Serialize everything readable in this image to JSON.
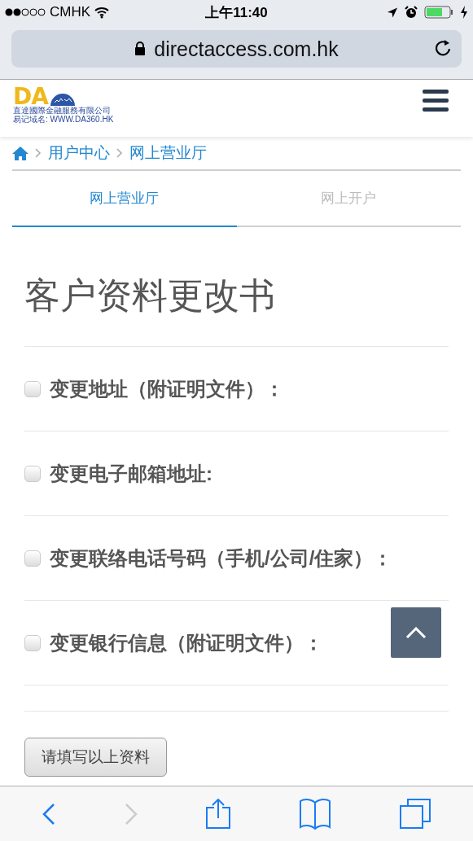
{
  "status_bar": {
    "carrier": "CMHK",
    "time": "上午11:40"
  },
  "browser": {
    "url": "directaccess.com.hk"
  },
  "header": {
    "logo": {
      "letters": "DA",
      "company": "直達國際金融服務有限公司",
      "domain": "易记域名: WWW.DA360.HK"
    }
  },
  "breadcrumb": [
    "用户中心",
    "网上营业厅"
  ],
  "tabs": [
    {
      "label": "网上营业厅",
      "selected": true
    },
    {
      "label": "网上开户",
      "selected": false
    }
  ],
  "form": {
    "title": "客户资料更改书",
    "options": [
      {
        "label": "变更地址（附证明文件）：",
        "checked": false
      },
      {
        "label": "变更电子邮箱地址:",
        "checked": false
      },
      {
        "label": "变更联络电话号码（手机/公司/住家）：",
        "checked": false
      },
      {
        "label": "变更银行信息（附证明文件）：",
        "checked": false
      }
    ],
    "button": "请填写以上资料"
  },
  "toolbar": {
    "back_disabled": false,
    "forward_disabled": true
  }
}
